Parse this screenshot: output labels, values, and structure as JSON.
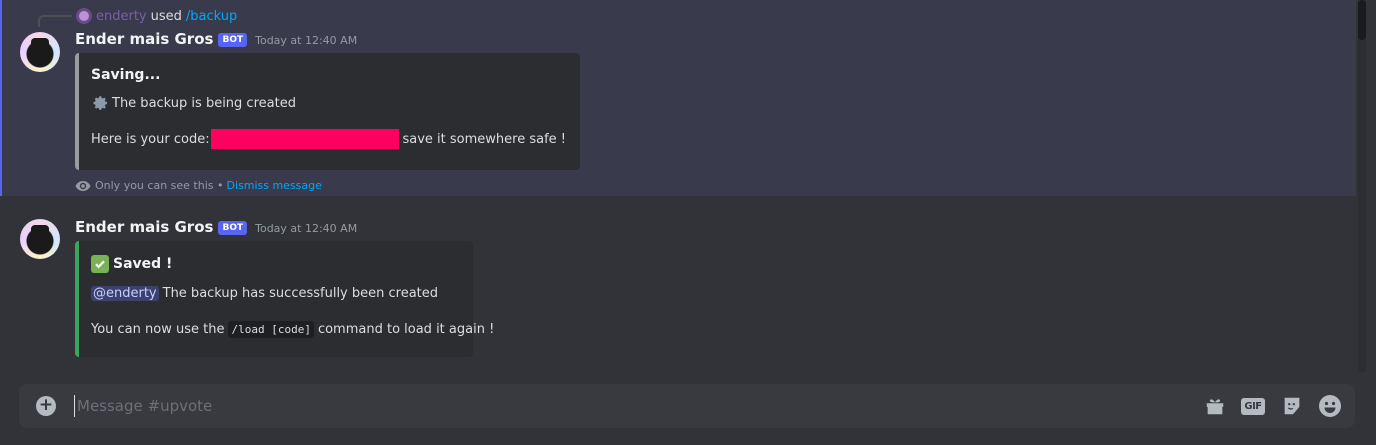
{
  "messages": [
    {
      "reply": {
        "user": "enderty",
        "used_label": "used",
        "command": "/backup"
      },
      "author": "Ender mais Gros",
      "bot_tag": "BOT",
      "timestamp": "Today at 12:40 AM",
      "embed": {
        "title": "Saving...",
        "line1": "The backup is being created",
        "line2_prefix": "Here is your code:",
        "line2_suffix": "save it somewhere safe !"
      },
      "ephemeral": {
        "note": "Only you can see this •",
        "dismiss": "Dismiss message"
      }
    },
    {
      "author": "Ender mais Gros",
      "bot_tag": "BOT",
      "timestamp": "Today at 12:40 AM",
      "embed": {
        "title": "Saved !",
        "mention": "@enderty",
        "line1": "The backup has successfully been created",
        "line2_prefix": "You can now use the",
        "code": "/load [code]",
        "line2_suffix": "command to load it again !"
      }
    }
  ],
  "composer": {
    "placeholder": "Message #upvote"
  },
  "icons": {
    "plus": "plus-circle-icon",
    "gift": "gift-icon",
    "gif": "GIF",
    "sticker": "sticker-icon",
    "emoji": "emoji-icon"
  },
  "colors": {
    "background": "#313338",
    "ephemeral_highlight": "#393a4b",
    "accent": "#5865f2",
    "success_bar": "#3ba55d",
    "redaction": "#ff005f",
    "link": "#00a8fc"
  }
}
